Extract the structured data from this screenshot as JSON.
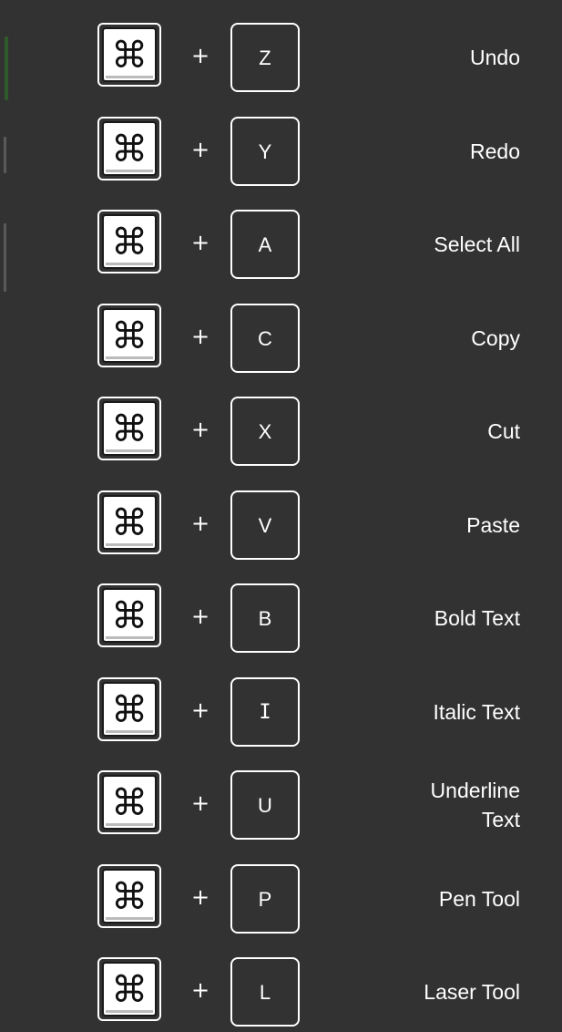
{
  "shortcuts": [
    {
      "modifier_icon": "command-key-icon",
      "plus": "+",
      "key": "Z",
      "action": "Undo"
    },
    {
      "modifier_icon": "command-key-icon",
      "plus": "+",
      "key": "Y",
      "action": "Redo"
    },
    {
      "modifier_icon": "command-key-icon",
      "plus": "+",
      "key": "A",
      "action": "Select All"
    },
    {
      "modifier_icon": "command-key-icon",
      "plus": "+",
      "key": "C",
      "action": "Copy"
    },
    {
      "modifier_icon": "command-key-icon",
      "plus": "+",
      "key": "X",
      "action": "Cut"
    },
    {
      "modifier_icon": "command-key-icon",
      "plus": "+",
      "key": "V",
      "action": "Paste"
    },
    {
      "modifier_icon": "command-key-icon",
      "plus": "+",
      "key": "B",
      "action": "Bold Text"
    },
    {
      "modifier_icon": "command-key-icon",
      "plus": "+",
      "key": "I",
      "action": "Italic Text"
    },
    {
      "modifier_icon": "command-key-icon",
      "plus": "+",
      "key": "U",
      "action": "Underline\nText"
    },
    {
      "modifier_icon": "command-key-icon",
      "plus": "+",
      "key": "P",
      "action": "Pen Tool"
    },
    {
      "modifier_icon": "command-key-icon",
      "plus": "+",
      "key": "L",
      "action": "Laser Tool"
    }
  ],
  "colors": {
    "background": "#323232",
    "text": "#ffffff",
    "key_border": "#ffffff",
    "command_key_fill": "#ffffff",
    "edge_accent": "#2f5a2a"
  }
}
